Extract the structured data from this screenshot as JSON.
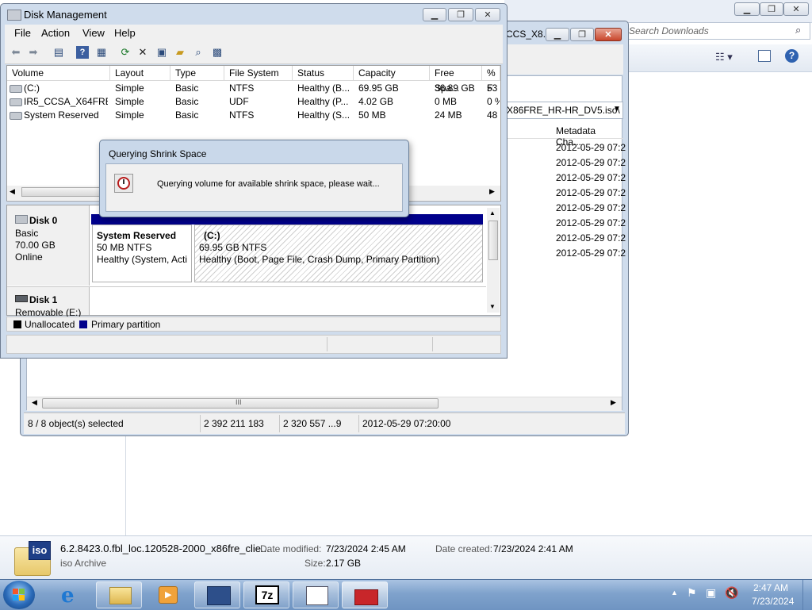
{
  "explorer": {
    "search_placeholder": "Search Downloads",
    "title_fragment": "CCS_X8...",
    "address_fragment": "X86FRE_HR-HR_DV5.iso\\",
    "column_metadata": "Metadata Cha...",
    "metadata_values": [
      "2012-05-29 07:2",
      "2012-05-29 07:2",
      "2012-05-29 07:2",
      "2012-05-29 07:2",
      "2012-05-29 07:2",
      "2012-05-29 07:2",
      "2012-05-29 07:2",
      "2012-05-29 07:2"
    ],
    "status": {
      "selected": "8 / 8 object(s) selected",
      "size": "2 392 211 183",
      "packed": "2 320 557 ...9",
      "date": "2012-05-29 07:20:00"
    },
    "scroll_grip": "III"
  },
  "disk_management": {
    "title": "Disk Management",
    "menu": [
      "File",
      "Action",
      "View",
      "Help"
    ],
    "columns": [
      "Volume",
      "Layout",
      "Type",
      "File System",
      "Status",
      "Capacity",
      "Free Spa...",
      "% F"
    ],
    "rows": [
      {
        "volume": "(C:)",
        "layout": "Simple",
        "type": "Basic",
        "fs": "NTFS",
        "status": "Healthy (B...",
        "capacity": "69.95 GB",
        "free": "36.89 GB",
        "pct": "53"
      },
      {
        "volume": "IR5_CCSA_X64FRE...",
        "layout": "Simple",
        "type": "Basic",
        "fs": "UDF",
        "status": "Healthy (P...",
        "capacity": "4.02 GB",
        "free": "0 MB",
        "pct": "0 %"
      },
      {
        "volume": "System Reserved",
        "layout": "Simple",
        "type": "Basic",
        "fs": "NTFS",
        "status": "Healthy (S...",
        "capacity": "50 MB",
        "free": "24 MB",
        "pct": "48"
      }
    ],
    "disk0": {
      "name": "Disk 0",
      "kind": "Basic",
      "size": "70.00 GB",
      "state": "Online"
    },
    "partition_sr": {
      "name": "System Reserved",
      "size": "50 MB NTFS",
      "status": "Healthy (System, Acti"
    },
    "partition_c": {
      "name": "(C:)",
      "size": "69.95 GB NTFS",
      "status": "Healthy (Boot, Page File, Crash Dump, Primary Partition)"
    },
    "disk1": {
      "name": "Disk 1",
      "kind": "Removable (E:)"
    },
    "legend": {
      "unallocated": "Unallocated",
      "primary": "Primary partition"
    }
  },
  "dialog": {
    "title": "Querying Shrink Space",
    "message": "Querying volume for available shrink space, please wait..."
  },
  "file_details": {
    "icon_label": "iso",
    "filename": "6.2.8423.0.fbl_loc.120528-2000_x86fre_clie...",
    "type": "iso Archive",
    "modified_label": "Date modified:",
    "modified_value": "7/23/2024 2:45 AM",
    "created_label": "Date created:",
    "created_value": "7/23/2024 2:41 AM",
    "size_label": "Size:",
    "size_value": "2.17 GB"
  },
  "taskbar": {
    "time": "2:47 AM",
    "date": "7/23/2024",
    "sevenzip_label": "7z"
  },
  "colors": {
    "primary_partition": "#00008b",
    "unallocated": "#000000",
    "taskbar": "#7fa2cc"
  }
}
